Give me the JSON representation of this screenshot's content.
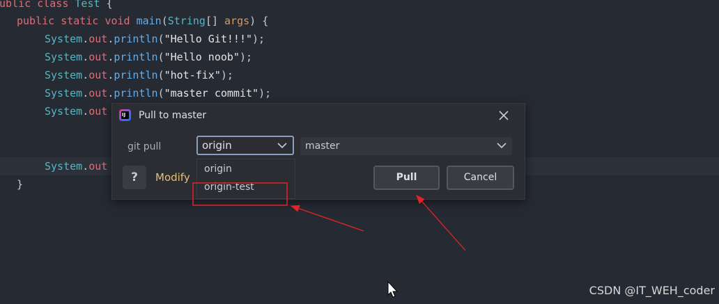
{
  "editor": {
    "lines": {
      "l0": {
        "kw1": "public",
        "kw2": "class",
        "name": "Test",
        "brace": "{"
      },
      "l1": {
        "kw1": "public",
        "kw2": "static",
        "kw3": "void",
        "fn": "main",
        "open": "(",
        "type": "String",
        "arr": "[]",
        "param": "args",
        "close": ")",
        "brace": "{"
      },
      "l2": {
        "sys": "System",
        "out": "out",
        "fn": "println",
        "str": "\"Hello Git!!!\""
      },
      "l3": {
        "sys": "System",
        "out": "out",
        "fn": "println",
        "str": "\"Hello noob\""
      },
      "l4": {
        "sys": "System",
        "out": "out",
        "fn": "println",
        "str": "\"hot-fix\""
      },
      "l5": {
        "sys": "System",
        "out": "out",
        "fn": "println",
        "str": "\"master commit\""
      },
      "l6": {
        "sys": "System",
        "out": "out"
      },
      "l7": {
        "sys": "System",
        "out": "out"
      },
      "l8": {
        "brace": "}"
      }
    }
  },
  "dialog": {
    "title": "Pull to master",
    "label": "git pull",
    "remote_value": "origin",
    "branch_value": "master",
    "help_label": "?",
    "modify_label": "Modify",
    "pull_label": "Pull",
    "cancel_label": "Cancel"
  },
  "dropdown": {
    "options": [
      "origin",
      "origin-test"
    ]
  },
  "watermark": "CSDN @IT_WEH_coder",
  "colors": {
    "background": "#262a33",
    "dialog": "#2b2d32",
    "annotation_red": "#e0242a",
    "link": "#e5c07b"
  }
}
